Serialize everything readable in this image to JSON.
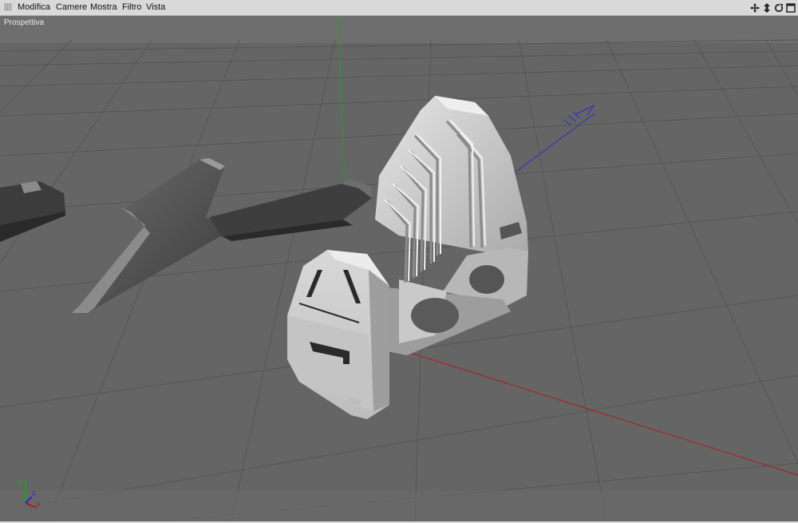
{
  "menubar": {
    "items": [
      {
        "id": "modifica",
        "label": "Modifica"
      },
      {
        "id": "camere",
        "label": "Camere"
      },
      {
        "id": "mostra",
        "label": "Mostra"
      },
      {
        "id": "filtro",
        "label": "Filtro"
      },
      {
        "id": "vista",
        "label": "Vista"
      }
    ],
    "nav_icons": [
      "move-icon",
      "zoom-icon",
      "rotate-icon",
      "maximize-icon"
    ]
  },
  "viewport": {
    "label": "Prospettiva",
    "axis_labels": {
      "y": "y",
      "z": "z",
      "x": "x"
    },
    "colors": {
      "background": "#656565",
      "grid": "#555555",
      "axis_x": "#b01818",
      "axis_y": "#20a020",
      "axis_z": "#2a2ad0"
    }
  }
}
